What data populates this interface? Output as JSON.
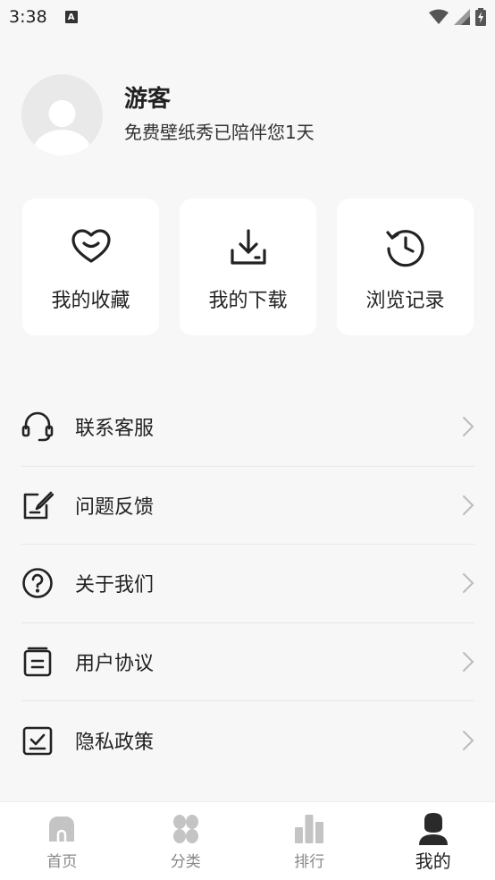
{
  "status_bar": {
    "time": "3:38",
    "notification_icon": "a-icon",
    "icons": [
      "wifi-icon",
      "signal-icon",
      "battery-charging-icon"
    ]
  },
  "profile": {
    "name": "游客",
    "subtitle": "免费壁纸秀已陪伴您1天"
  },
  "quick_actions": [
    {
      "label": "我的收藏",
      "icon": "heart-icon"
    },
    {
      "label": "我的下载",
      "icon": "download-icon"
    },
    {
      "label": "浏览记录",
      "icon": "history-icon"
    }
  ],
  "menu": [
    {
      "label": "联系客服",
      "icon": "headset-icon"
    },
    {
      "label": "问题反馈",
      "icon": "feedback-icon"
    },
    {
      "label": "关于我们",
      "icon": "help-icon"
    },
    {
      "label": "用户协议",
      "icon": "document-icon"
    },
    {
      "label": "隐私政策",
      "icon": "shield-check-icon"
    }
  ],
  "bottom_nav": {
    "active": "我的",
    "items": [
      {
        "label": "首页",
        "icon": "home-icon"
      },
      {
        "label": "分类",
        "icon": "category-icon"
      },
      {
        "label": "排行",
        "icon": "ranking-icon"
      },
      {
        "label": "我的",
        "icon": "user-icon"
      }
    ]
  },
  "colors": {
    "background": "#f7f7f7",
    "card": "#ffffff",
    "text": "#222222",
    "inactive": "#bdbdbd"
  }
}
